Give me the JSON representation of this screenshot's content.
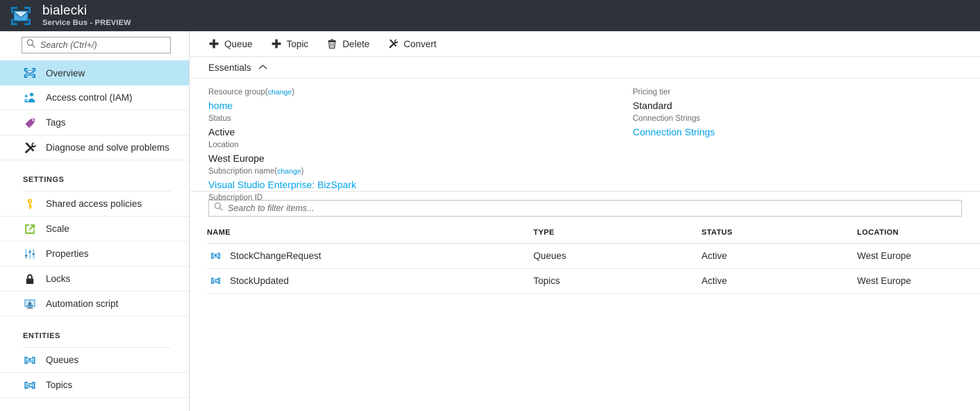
{
  "header": {
    "icon": "service-bus-icon",
    "title": "bialecki",
    "subtitle": "Service Bus - PREVIEW"
  },
  "sidebar": {
    "search": {
      "placeholder": "Search (Ctrl+/)",
      "value": "",
      "icon": "search-icon"
    },
    "items": [
      {
        "label": "Overview",
        "icon": "service-bus-icon",
        "selected": true
      },
      {
        "label": "Access control (IAM)",
        "icon": "people-icon",
        "selected": false
      },
      {
        "label": "Tags",
        "icon": "tag-icon",
        "selected": false
      },
      {
        "label": "Diagnose and solve problems",
        "icon": "wrench-screwdriver-icon",
        "selected": false
      }
    ],
    "groups": [
      {
        "title": "SETTINGS",
        "items": [
          {
            "label": "Shared access policies",
            "icon": "key-icon"
          },
          {
            "label": "Scale",
            "icon": "scale-arrow-icon"
          },
          {
            "label": "Properties",
            "icon": "sliders-icon"
          },
          {
            "label": "Locks",
            "icon": "lock-icon"
          },
          {
            "label": "Automation script",
            "icon": "monitor-download-icon"
          }
        ]
      },
      {
        "title": "ENTITIES",
        "items": [
          {
            "label": "Queues",
            "icon": "queue-icon"
          },
          {
            "label": "Topics",
            "icon": "topic-icon"
          }
        ]
      }
    ]
  },
  "toolbar": {
    "buttons": [
      {
        "label": "Queue",
        "icon": "plus-icon"
      },
      {
        "label": "Topic",
        "icon": "plus-icon"
      },
      {
        "label": "Delete",
        "icon": "trash-icon"
      },
      {
        "label": "Convert",
        "icon": "wrench-screwdriver-icon"
      }
    ]
  },
  "essentials": {
    "title": "Essentials",
    "collapse_icon": "chevron-up-icon",
    "left": [
      {
        "key": "Resource group",
        "change": "change",
        "value": "home",
        "link": true
      },
      {
        "key": "Status",
        "value": "Active",
        "link": false
      },
      {
        "key": "Location",
        "value": "West Europe",
        "link": false
      },
      {
        "key": "Subscription name",
        "change": "change",
        "value": "Visual Studio Enterprise: BizSpark",
        "link": true
      },
      {
        "key": "Subscription ID",
        "value": "",
        "link": false
      }
    ],
    "right": [
      {
        "key": "Pricing tier",
        "value": "Standard",
        "link": false
      },
      {
        "key": "Connection Strings",
        "value": "Connection Strings",
        "link": true
      }
    ]
  },
  "list": {
    "filter": {
      "placeholder": "Search to filter items...",
      "value": "",
      "icon": "search-icon"
    },
    "columns": [
      "NAME",
      "TYPE",
      "STATUS",
      "LOCATION"
    ],
    "rows": [
      {
        "icon": "queue-icon",
        "name": "StockChangeRequest",
        "type": "Queues",
        "status": "Active",
        "location": "West Europe"
      },
      {
        "icon": "topic-icon",
        "name": "StockUpdated",
        "type": "Topics",
        "status": "Active",
        "location": "West Europe"
      }
    ]
  },
  "colors": {
    "header_bg": "#2e333b",
    "accent_link": "#00a2e8",
    "selected_nav": "#b9e6f7"
  }
}
